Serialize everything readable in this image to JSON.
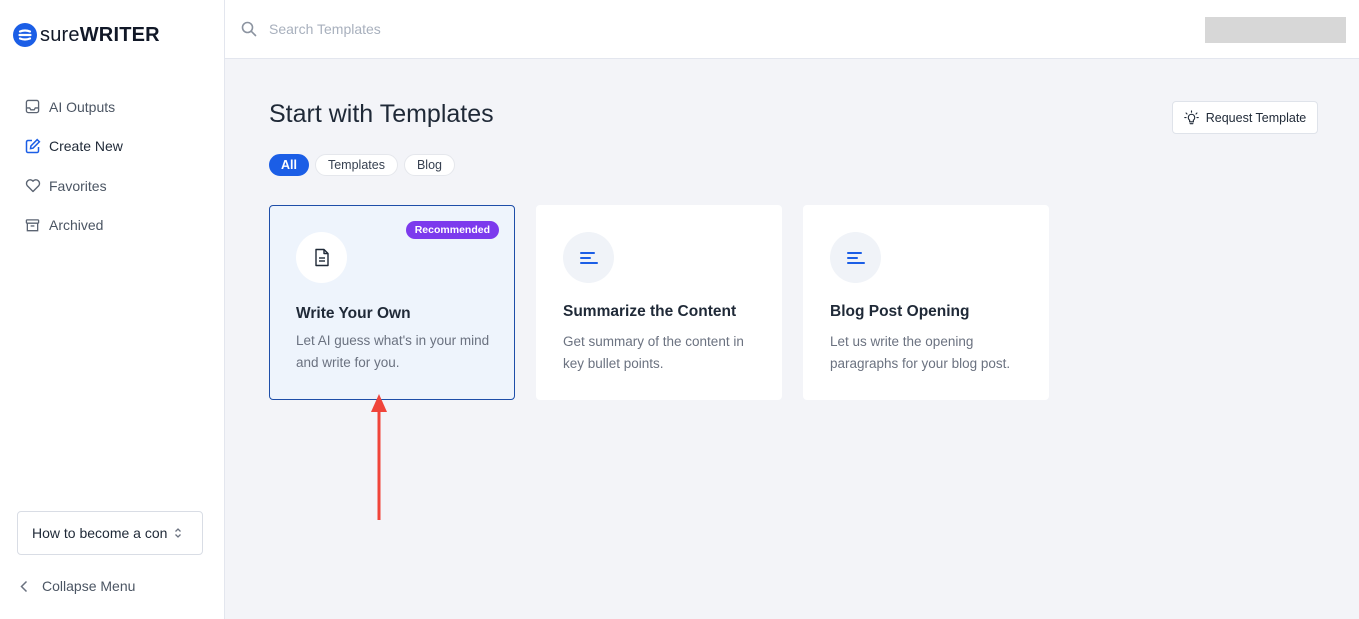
{
  "app": {
    "logo_light": "sure",
    "logo_bold": "WRITER",
    "brand_color": "#1b5ee6"
  },
  "sidebar": {
    "items": [
      {
        "label": "AI Outputs",
        "icon": "inbox-icon"
      },
      {
        "label": "Create New",
        "icon": "edit-icon"
      },
      {
        "label": "Favorites",
        "icon": "heart-icon"
      },
      {
        "label": "Archived",
        "icon": "archive-icon"
      }
    ],
    "project_select": {
      "value": "How to become a con"
    },
    "collapse_label": "Collapse Menu"
  },
  "search": {
    "placeholder": "Search Templates",
    "value": ""
  },
  "main": {
    "title": "Start with Templates",
    "request_button": "Request Template",
    "filters": [
      "All",
      "Templates",
      "Blog"
    ],
    "active_filter": "All",
    "cards": [
      {
        "title": "Write Your Own",
        "description": "Let AI guess what's in your mind and write for you.",
        "badge": "Recommended",
        "icon": "document-icon",
        "selected": true
      },
      {
        "title": "Summarize the Content",
        "description": "Get summary of the content in key bullet points.",
        "icon": "text-lines-icon",
        "selected": false
      },
      {
        "title": "Blog Post Opening",
        "description": "Let us write the opening paragraphs for your blog post.",
        "icon": "text-lines-icon",
        "selected": false
      }
    ]
  },
  "colors": {
    "badge": "#7c3aed",
    "selected_card_border": "#1e4ea8",
    "annotation_arrow": "#f0443a"
  }
}
